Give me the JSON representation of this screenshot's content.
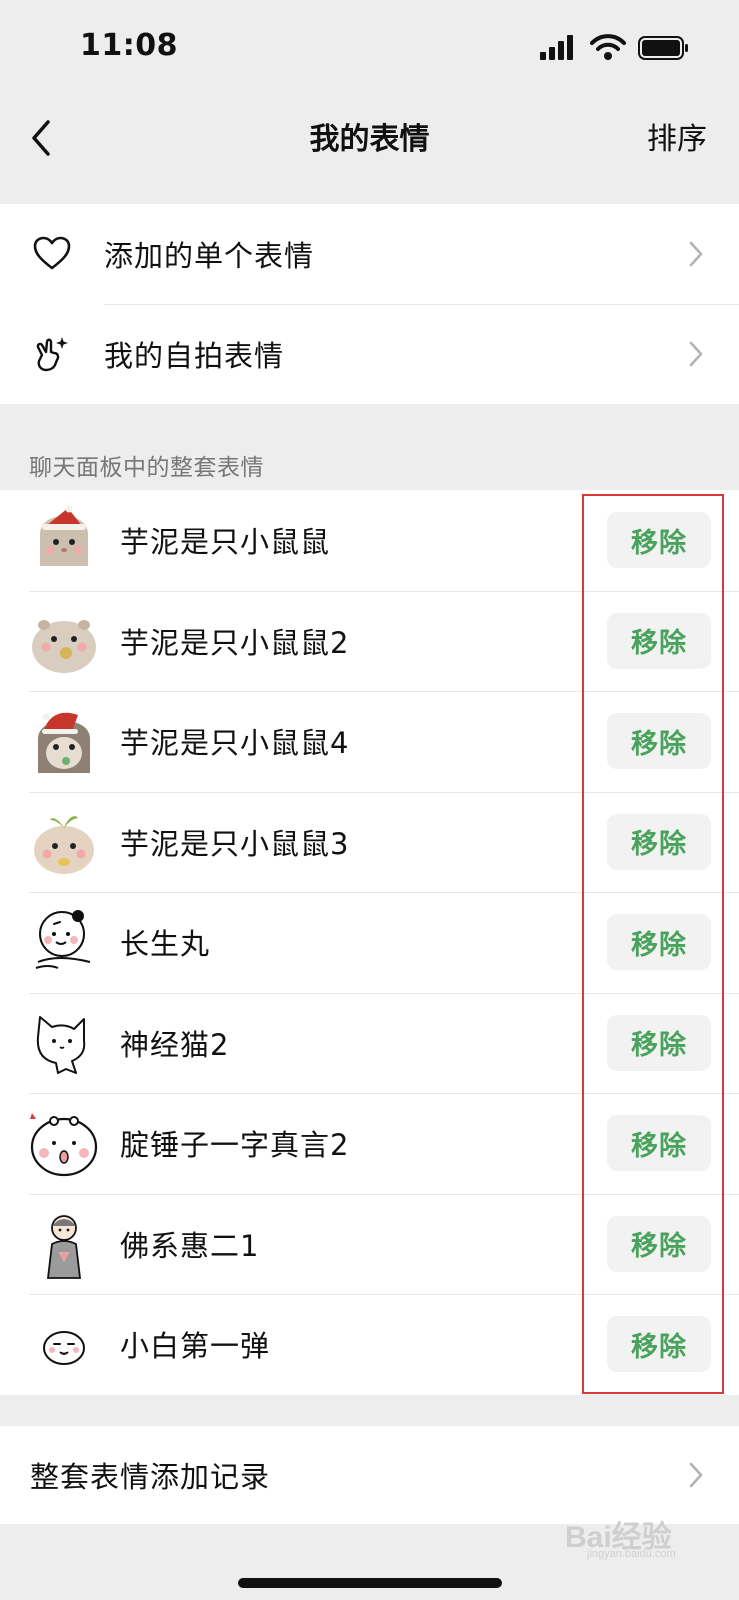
{
  "status_bar": {
    "time": "11:08",
    "icons": [
      "signal-icon",
      "wifi-icon",
      "battery-icon"
    ]
  },
  "nav": {
    "title": "我的表情",
    "action": "排序",
    "back_icon": "chevron-left-icon"
  },
  "menu": [
    {
      "icon": "heart-icon",
      "label": "添加的单个表情"
    },
    {
      "icon": "hand-sparkle-icon",
      "label": "我的自拍表情"
    }
  ],
  "section_header": "聊天面板中的整套表情",
  "packs": [
    {
      "name": "芋泥是只小鼠鼠",
      "thumb": "hamster-santa-sticker",
      "button": "移除"
    },
    {
      "name": "芋泥是只小鼠鼠2",
      "thumb": "hamster-eating-sticker",
      "button": "移除"
    },
    {
      "name": "芋泥是只小鼠鼠4",
      "thumb": "hamster-hat-sticker",
      "button": "移除"
    },
    {
      "name": "芋泥是只小鼠鼠3",
      "thumb": "hamster-sprout-sticker",
      "button": "移除"
    },
    {
      "name": "长生丸",
      "thumb": "round-man-sticker",
      "button": "移除"
    },
    {
      "name": "神经猫2",
      "thumb": "white-cat-sticker",
      "button": "移除"
    },
    {
      "name": "腚锤子一字真言2",
      "thumb": "round-face-sticker",
      "button": "移除"
    },
    {
      "name": "佛系惠二1",
      "thumb": "monk-sticker",
      "button": "移除"
    },
    {
      "name": "小白第一弹",
      "thumb": "white-bun-sticker",
      "button": "移除"
    }
  ],
  "history": {
    "label": "整套表情添加记录"
  },
  "watermark": {
    "main": "Bai经验",
    "sub": "jingyan.baidu.com"
  },
  "colors": {
    "accent_green": "#4aa35c",
    "highlight_red": "#d63a3a",
    "background": "#ededed"
  }
}
